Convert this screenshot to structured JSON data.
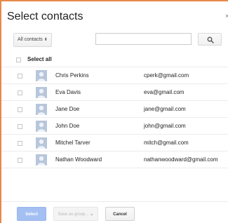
{
  "dialog": {
    "title": "Select contacts",
    "close_glyph": "×"
  },
  "filter": {
    "dropdown_label": "All contacts",
    "dropdown_glyph": "⬍"
  },
  "search": {
    "value": "",
    "placeholder": "",
    "icon": "search-icon"
  },
  "select_all": {
    "label": "Select all",
    "checked": false
  },
  "contacts": [
    {
      "name": "Chris Perkins",
      "email": "cperk@gmail.com",
      "checked": false
    },
    {
      "name": "Eva Davis",
      "email": "eva@gmail.com",
      "checked": false
    },
    {
      "name": "Jane Doe",
      "email": "jane@gmail.com",
      "checked": false
    },
    {
      "name": "John Doe",
      "email": "john@gmail.com",
      "checked": false
    },
    {
      "name": "Mitchel Tarver",
      "email": "mitch@gmail.com",
      "checked": false
    },
    {
      "name": "Nathan Woodward",
      "email": "nathanwoodward@gmail.com",
      "checked": false
    }
  ],
  "footer": {
    "select_label": "Select",
    "save_as_group_label": "Save as group...",
    "save_as_group_caret": "▲",
    "cancel_label": "Cancel"
  },
  "colors": {
    "accent_border": "#e7894a",
    "primary_button_disabled": "#a4bff2",
    "avatar_bg": "#b7c6da"
  }
}
